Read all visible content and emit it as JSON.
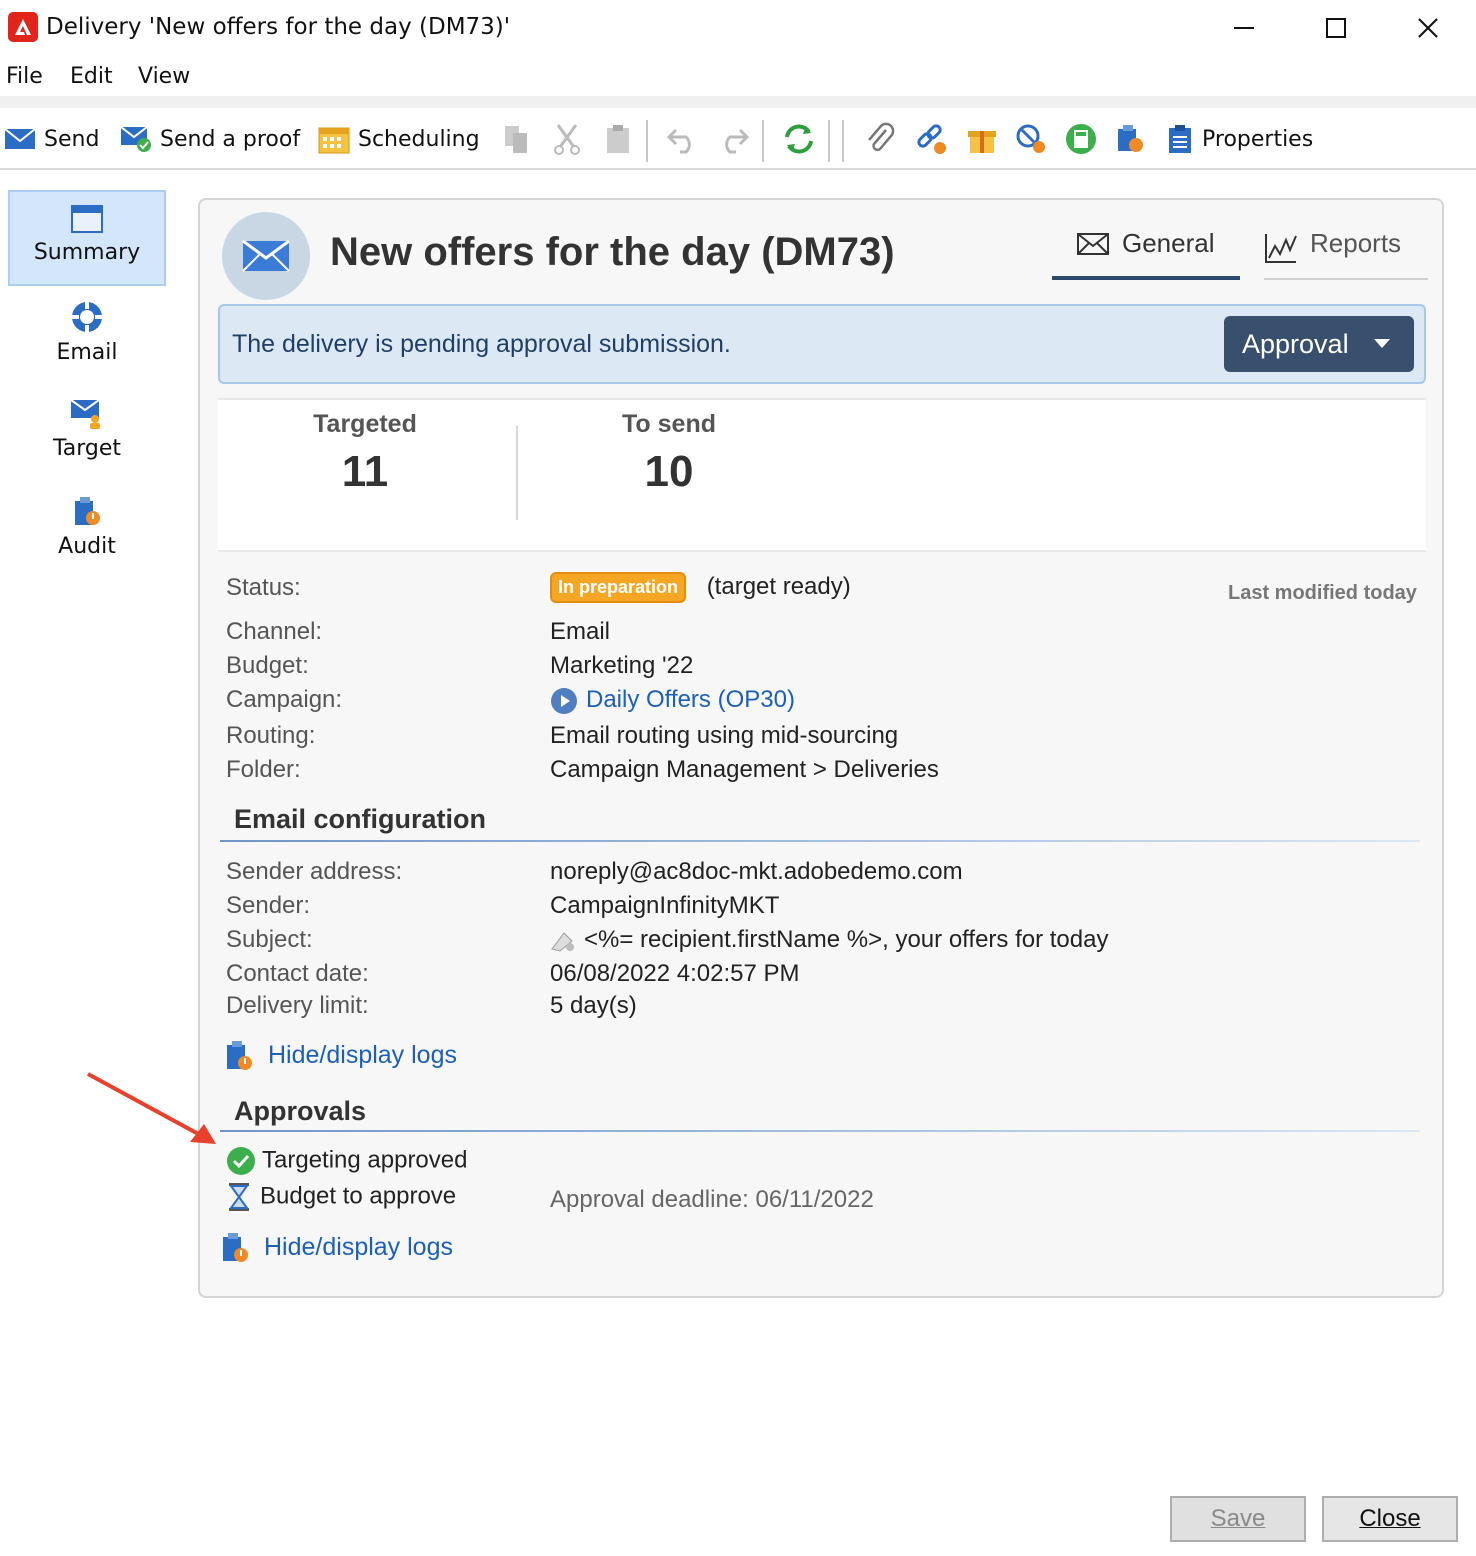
{
  "window": {
    "title": "Delivery 'New offers for the day (DM73)'"
  },
  "menu": {
    "file": "File",
    "edit": "Edit",
    "view": "View"
  },
  "toolbar": {
    "send": "Send",
    "send_proof": "Send a proof",
    "scheduling": "Scheduling",
    "properties": "Properties"
  },
  "sidebar": {
    "items": [
      {
        "label": "Summary"
      },
      {
        "label": "Email"
      },
      {
        "label": "Target"
      },
      {
        "label": "Audit"
      }
    ]
  },
  "header": {
    "title": "New offers for the day (DM73)"
  },
  "tabs": {
    "general": "General",
    "reports": "Reports"
  },
  "banner": {
    "text": "The delivery is pending approval submission.",
    "button": "Approval"
  },
  "kpis": {
    "targeted_label": "Targeted",
    "targeted_value": "11",
    "tosend_label": "To send",
    "tosend_value": "10"
  },
  "details": {
    "status_label": "Status:",
    "status_badge": "In preparation",
    "status_note": "(target ready)",
    "last_modified": "Last modified today",
    "channel_label": "Channel:",
    "channel_value": "Email",
    "budget_label": "Budget:",
    "budget_value": "Marketing '22",
    "campaign_label": "Campaign:",
    "campaign_value": "Daily Offers (OP30)",
    "routing_label": "Routing:",
    "routing_value": "Email routing using mid-sourcing",
    "folder_label": "Folder:",
    "folder_value": "Campaign Management > Deliveries"
  },
  "email_config": {
    "title": "Email configuration",
    "sender_address_label": "Sender address:",
    "sender_address_value": "noreply@ac8doc-mkt.adobedemo.com",
    "sender_label": "Sender:",
    "sender_value": "CampaignInfinityMKT",
    "subject_label": "Subject:",
    "subject_value": "<%= recipient.firstName %>, your offers for today",
    "contact_date_label": "Contact date:",
    "contact_date_value": "06/08/2022 4:02:57 PM",
    "delivery_limit_label": "Delivery limit:",
    "delivery_limit_value": "5 day(s)",
    "logs_link": "Hide/display logs"
  },
  "approvals": {
    "title": "Approvals",
    "targeting": "Targeting approved",
    "budget": "Budget to approve",
    "deadline": "Approval deadline: 06/11/2022",
    "logs_link": "Hide/display logs"
  },
  "footer": {
    "save": "Save",
    "close": "Close"
  },
  "colors": {
    "accent": "#394f6e",
    "link": "#1b5fb8",
    "badge": "#f5a623",
    "banner_bg": "#dce9f5",
    "annotation_arrow": "#e8402a"
  }
}
